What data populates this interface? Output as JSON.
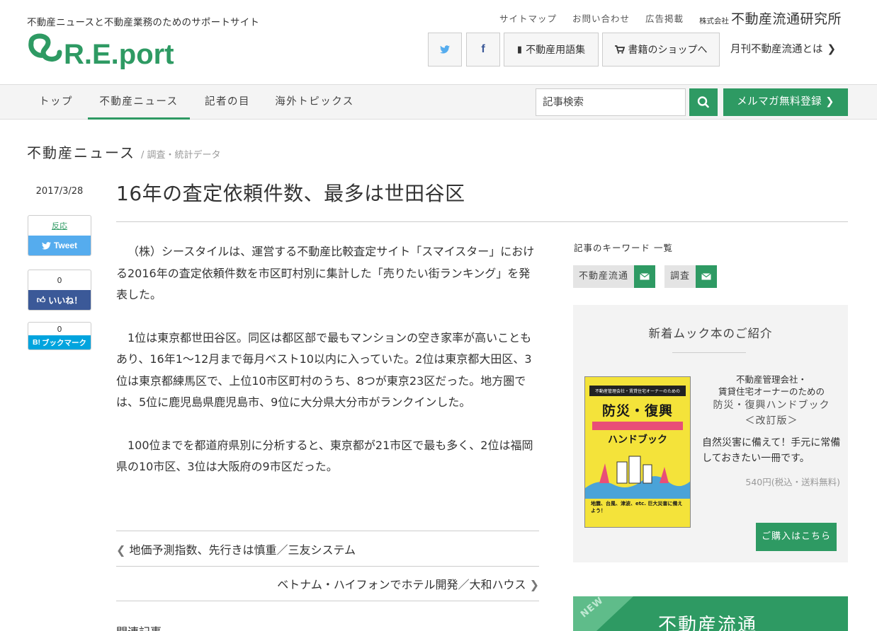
{
  "header": {
    "tagline": "不動産ニュースと不動産業務のためのサポートサイト",
    "logo_text": "R.E.port",
    "links": [
      "サイトマップ",
      "お問い合わせ",
      "広告掲載"
    ],
    "company_prefix": "株式会社",
    "company_name": "不動産流通研究所",
    "glossary_label": "不動産用語集",
    "shop_label": "書籍のショップへ",
    "monthly_label": "月刊不動産流通とは"
  },
  "nav": {
    "items": [
      "トップ",
      "不動産ニュース",
      "記者の目",
      "海外トピックス"
    ],
    "active": "不動産ニュース",
    "search_placeholder": "記事検索",
    "mail_label": "メルマガ無料登録"
  },
  "breadcrumb": {
    "main": "不動産ニュース",
    "sub": "/ 調査・統計データ"
  },
  "article": {
    "date": "2017/3/28",
    "title": "16年の査定依頼件数、最多は世田谷区",
    "paragraphs": [
      "（株）シースタイルは、運営する不動産比較査定サイト「スマイスター」における2016年の査定依頼件数を市区町村別に集計した「売りたい街ランキング」を発表した。",
      "1位は東京都世田谷区。同区は都区部で最もマンションの空き家率が高いこともあり、16年1～12月まで毎月ベスト10以内に入っていた。2位は東京都大田区、3位は東京都練馬区で、上位10市区町村のうち、8つが東京23区だった。地方圏では、5位に鹿児島県鹿児島市、9位に大分県大分市がランクインした。",
      "100位までを都道府県別に分析すると、東京都が21市区で最も多く、2位は福岡県の10市区、3位は大阪府の9市区だった。"
    ],
    "prev": "地価予測指数、先行きは慎重／三友システム",
    "next": "ベトナム・ハイフォンでホテル開発／大和ハウス",
    "related_heading": "関連記事"
  },
  "share": {
    "tweet_count": "反応",
    "tweet_label": "Tweet",
    "like_count": "0",
    "like_label": "いいね！",
    "hatena_count": "0",
    "hatena_label": "ブックマーク"
  },
  "sidebar": {
    "keywords_title": "記事のキーワード 一覧",
    "keywords": [
      "不動産流通",
      "調査"
    ],
    "mook": {
      "title": "新着ムック本のご紹介",
      "sub1": "不動産管理会社・",
      "sub2": "賃貸住宅オーナーのための",
      "name1": "防災・復興ハンドブック",
      "name2": "＜改訂版＞",
      "desc": "自然災害に備えて！手元に常備しておきたい一冊です。",
      "price": "540円(税込・送料無料)",
      "buy_label": "ご購入はこちら",
      "cover_top": "不動産管理会社・賃貸住宅オーナーのための",
      "cover_main1": "防災・復興",
      "cover_main2": "ハンドブック",
      "cover_bottom": "地震、台風、津波、etc. 巨大災害に備えよう！"
    },
    "banner": {
      "new": "NEW",
      "name": "不動産流通"
    }
  },
  "colors": {
    "accent": "#2e9a63",
    "twitter": "#55acee",
    "facebook": "#3b5998",
    "hatena": "#00a4de"
  }
}
